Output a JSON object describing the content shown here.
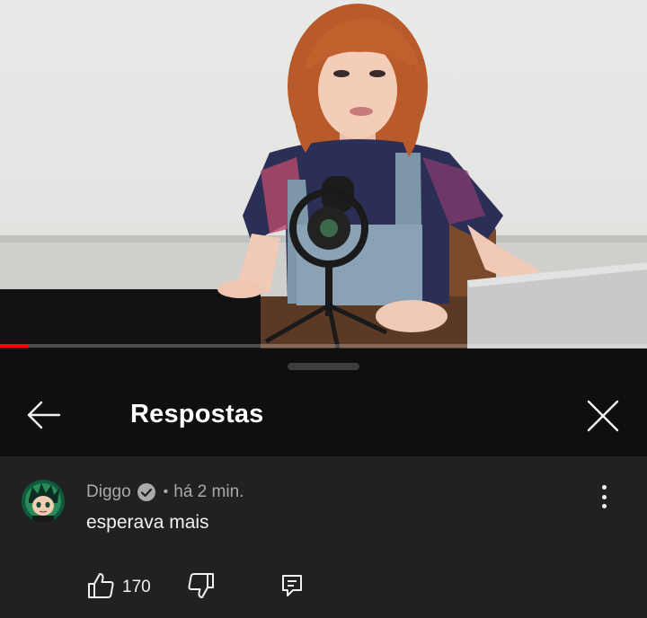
{
  "video": {
    "progress_fraction": 0.044
  },
  "header": {
    "title": "Respostas",
    "back_icon": "arrow-left-icon",
    "close_icon": "close-icon"
  },
  "comment": {
    "author": "Diggo",
    "verified": true,
    "time_ago": "há 2 min.",
    "separator": "•",
    "text": "esperava mais",
    "like_count": "170",
    "icons": {
      "like": "thumb-up-icon",
      "dislike": "thumb-down-icon",
      "reply": "comment-reply-icon",
      "more": "more-vert-icon"
    }
  },
  "colors": {
    "background": "#0f0f0f",
    "comment_background": "#212121",
    "progress": "#ff0000",
    "secondary_text": "#aaaaaa"
  }
}
